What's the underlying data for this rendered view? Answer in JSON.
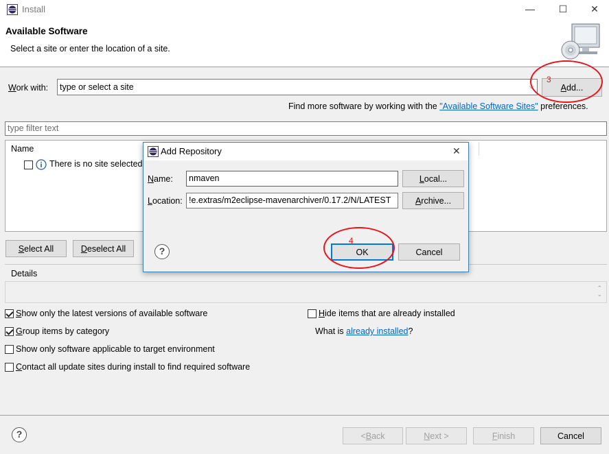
{
  "window": {
    "title": "Install",
    "minimize_glyph": "—",
    "maximize_glyph": "☐",
    "close_glyph": "✕"
  },
  "header": {
    "heading": "Available Software",
    "subtitle": "Select a site or enter the location of a site."
  },
  "work_with": {
    "label_prefix": "W",
    "label_rest": "ork with:",
    "value": "type or select a site",
    "add_prefix": "",
    "add_underlined": "A",
    "add_rest": "dd..."
  },
  "find_more": {
    "prefix": "Find more software by working with the ",
    "link": "\"Available Software Sites\"",
    "suffix": " preferences."
  },
  "filter": {
    "placeholder": "type filter text"
  },
  "tree": {
    "column_name": "Name",
    "row_text": "There is no site selected."
  },
  "select_buttons": {
    "select_all_u": "S",
    "select_all_rest": "elect All",
    "deselect_all_u": "D",
    "deselect_all_rest": "eselect All"
  },
  "details": {
    "label": "Details"
  },
  "options": {
    "latest": {
      "u": "S",
      "rest": "how only the latest versions of available software",
      "checked": true
    },
    "group": {
      "u": "G",
      "rest": "roup items by category",
      "checked": true
    },
    "target": {
      "prefix": "Show only software applicable to target environment",
      "checked": false
    },
    "contact": {
      "u": "C",
      "rest": "ontact all update sites during install to find required software",
      "checked": false
    },
    "hide": {
      "u": "H",
      "rest": "ide items that are already installed",
      "checked": false
    },
    "what_is_prefix": "What is ",
    "what_is_link": "already installed",
    "what_is_suffix": "?"
  },
  "footer": {
    "back_u": "B",
    "back_pre": "< ",
    "back_rest": "ack",
    "next_u": "N",
    "next_rest": "ext >",
    "finish_u": "F",
    "finish_rest": "inish",
    "cancel": "Cancel"
  },
  "dialog": {
    "title": "Add Repository",
    "name_label_u": "N",
    "name_label_rest": "ame:",
    "name_value": "nmaven",
    "location_label_u": "L",
    "location_label_rest": "ocation:",
    "location_value": "!e.extras/m2eclipse-mavenarchiver/0.17.2/N/LATEST",
    "local_u": "L",
    "local_pre": "",
    "local_rest": "ocal...",
    "archive_u": "A",
    "archive_rest": "rchive...",
    "ok": "OK",
    "cancel": "Cancel"
  },
  "annotations": {
    "step3": "3",
    "step4": "4"
  },
  "colors": {
    "accent": "#0078d7",
    "link": "#0066cc",
    "annotation_red": "#e8141c"
  }
}
